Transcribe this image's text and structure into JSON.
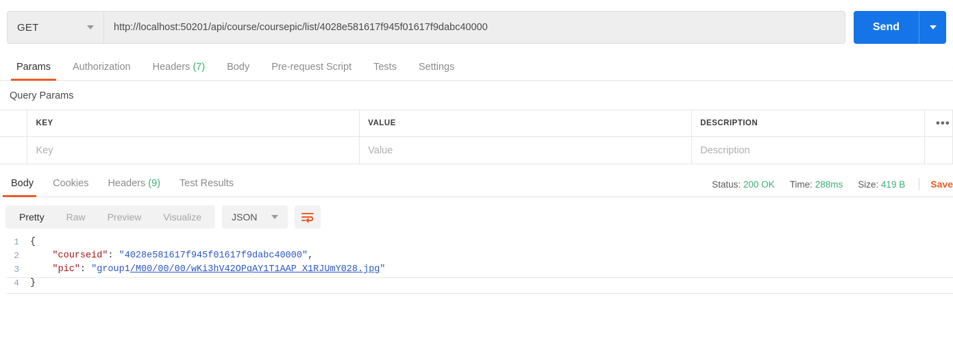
{
  "request": {
    "method": "GET",
    "url": "http://localhost:50201/api/course/coursepic/list/4028e581617f945f01617f9dabc40000",
    "send_label": "Send",
    "tabs": [
      {
        "label": "Params",
        "active": true
      },
      {
        "label": "Authorization",
        "active": false
      },
      {
        "label": "Headers",
        "count": "(7)",
        "active": false
      },
      {
        "label": "Body",
        "active": false
      },
      {
        "label": "Pre-request Script",
        "active": false
      },
      {
        "label": "Tests",
        "active": false
      },
      {
        "label": "Settings",
        "active": false
      }
    ]
  },
  "params": {
    "section_title": "Query Params",
    "headers": [
      "KEY",
      "VALUE",
      "DESCRIPTION"
    ],
    "placeholder_row": [
      "Key",
      "Value",
      "Description"
    ],
    "more_icon": "•••"
  },
  "response": {
    "tabs": [
      {
        "label": "Body",
        "active": true
      },
      {
        "label": "Cookies",
        "active": false
      },
      {
        "label": "Headers",
        "count": "(9)",
        "active": false
      },
      {
        "label": "Test Results",
        "active": false
      }
    ],
    "status_label": "Status:",
    "status_value": "200 OK",
    "time_label": "Time:",
    "time_value": "288ms",
    "size_label": "Size:",
    "size_value": "419 B",
    "save_label": "Save",
    "viewer_modes": [
      {
        "label": "Pretty",
        "active": true
      },
      {
        "label": "Raw",
        "active": false
      },
      {
        "label": "Preview",
        "active": false
      },
      {
        "label": "Visualize",
        "active": false
      }
    ],
    "format": "JSON",
    "wrap_icon": "word-wrap-icon",
    "body_lines": [
      {
        "no": "1",
        "indent": "",
        "text": "{"
      },
      {
        "no": "2",
        "key": "\"courseid\"",
        "sep": ": ",
        "value": "\"4028e581617f945f01617f9dabc40000\"",
        "tail": ","
      },
      {
        "no": "3",
        "key": "\"pic\"",
        "sep": ": ",
        "value_prefix": "\"group1",
        "value_link": "/M00/00/00/wKi3hV42OPqAY1T1AAP_X1RJUmY028.jpg",
        "tail_quote": "\""
      },
      {
        "no": "4",
        "indent": "",
        "text": "}"
      }
    ]
  },
  "colors": {
    "accent_orange": "#ef5b25",
    "send_blue": "#1574e8",
    "status_green": "#3bb077",
    "json_key": "#a31515",
    "json_value": "#2b57c4"
  }
}
